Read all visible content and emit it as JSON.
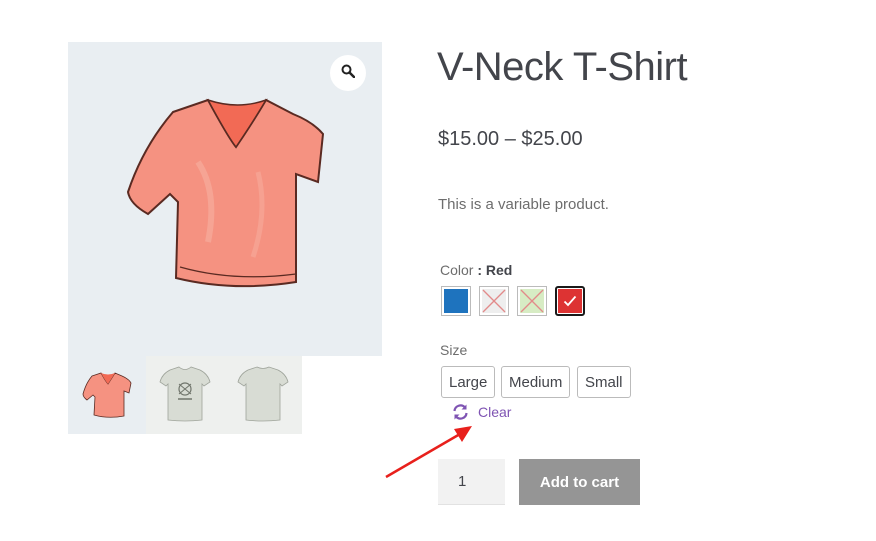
{
  "product": {
    "title": "V-Neck T-Shirt",
    "price_range": "$15.00 – $25.00",
    "description": "This is a variable product."
  },
  "gallery": {
    "zoom_icon": "magnifier-icon",
    "thumbnails": [
      "v-neck-red",
      "tshirt-logo-grey",
      "tshirt-back-grey"
    ]
  },
  "color": {
    "label": "Color",
    "selected_value": ": Red",
    "swatches": [
      {
        "name": "Blue",
        "color": "#1e73be",
        "available": true
      },
      {
        "name": "Grey",
        "color": "#eeeeee",
        "available": false
      },
      {
        "name": "Green",
        "color": "#d7ecc4",
        "available": false
      },
      {
        "name": "Red",
        "color": "#dd3333",
        "available": true,
        "selected": true
      }
    ]
  },
  "size": {
    "label": "Size",
    "options": [
      "Large",
      "Medium",
      "Small"
    ]
  },
  "clear_label": "Clear",
  "quantity": "1",
  "add_to_cart_label": "Add to cart",
  "colors": {
    "link": "#7f54b3",
    "button_disabled": "#959595",
    "annotation_arrow": "#e8201c"
  }
}
